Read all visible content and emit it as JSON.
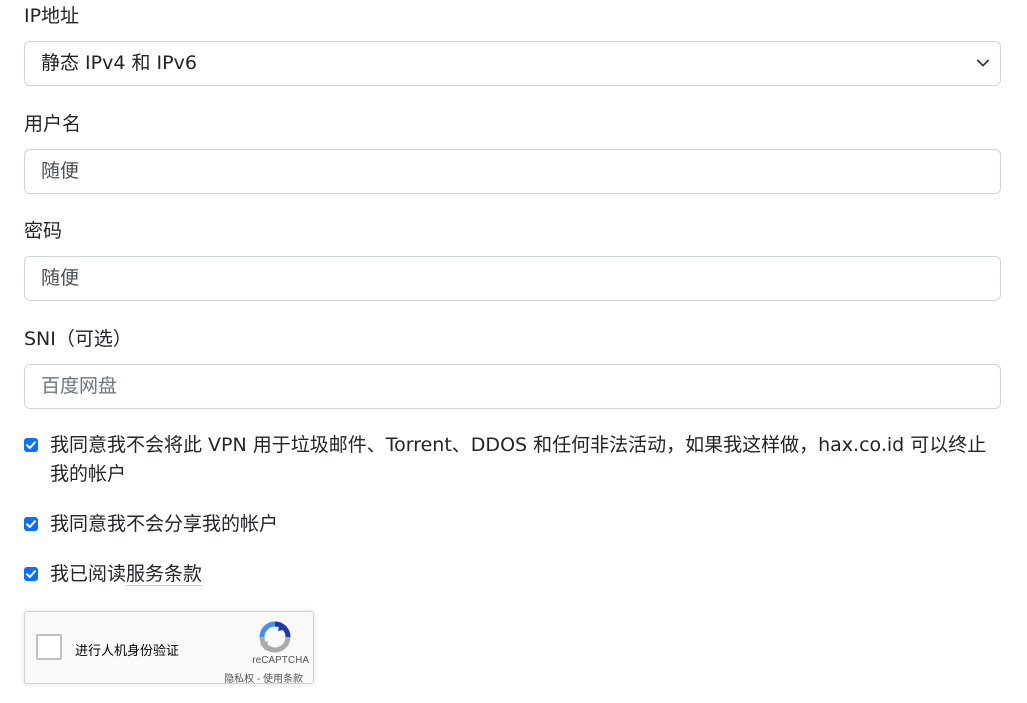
{
  "fields": {
    "ip": {
      "label": "IP地址",
      "value": "静态 IPv4 和 IPv6"
    },
    "username": {
      "label": "用户名",
      "value": "随便"
    },
    "password": {
      "label": "密码",
      "value": "随便"
    },
    "sni": {
      "label": "SNI（可选）",
      "placeholder": "百度网盘"
    }
  },
  "checkboxes": [
    {
      "text": "我同意我不会将此 VPN 用于垃圾邮件、Torrent、DDOS 和任何非法活动，如果我这样做，hax.co.id 可以终止我的帐户",
      "checked": true
    },
    {
      "text": "我同意我不会分享我的帐户",
      "checked": true
    },
    {
      "text_prefix": "我已阅读",
      "link": "服务条款",
      "checked": true
    }
  ],
  "recaptcha": {
    "label": "进行人机身份验证",
    "brand": "reCAPTCHA",
    "privacy": "隐私权",
    "separator": "-",
    "terms": "使用条款"
  },
  "colors": {
    "accent": "#0d6efd",
    "recaptcha_blue": "#1c3aa9",
    "recaptcha_light": "#4a90e2",
    "recaptcha_gray": "#ababab"
  }
}
